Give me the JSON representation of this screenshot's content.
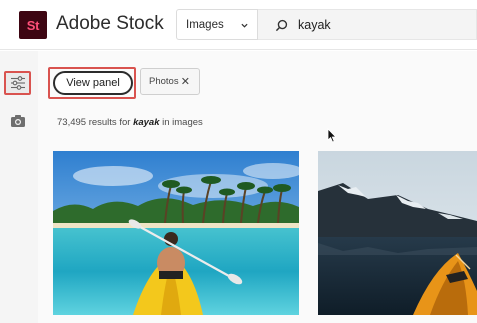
{
  "app": {
    "logo_text": "St",
    "brand": "Adobe Stock"
  },
  "search": {
    "type_selected": "Images",
    "query": "kayak"
  },
  "toolbar": {
    "view_panel_label": "View panel",
    "filter_chip_label": "Photos",
    "filter_chip_remove": "✕"
  },
  "results": {
    "count": "73,495",
    "text_mid": "results for",
    "term": "kayak",
    "text_end": "in images"
  },
  "icons": {
    "filter": "sliders-icon",
    "camera": "camera-icon",
    "search": "search-icon",
    "chevron": "chevron-down-icon"
  },
  "colors": {
    "logo_bg": "#3d0512",
    "logo_text": "#ff4f79",
    "highlight": "#d9534f",
    "kayak": "#f3c81c"
  }
}
